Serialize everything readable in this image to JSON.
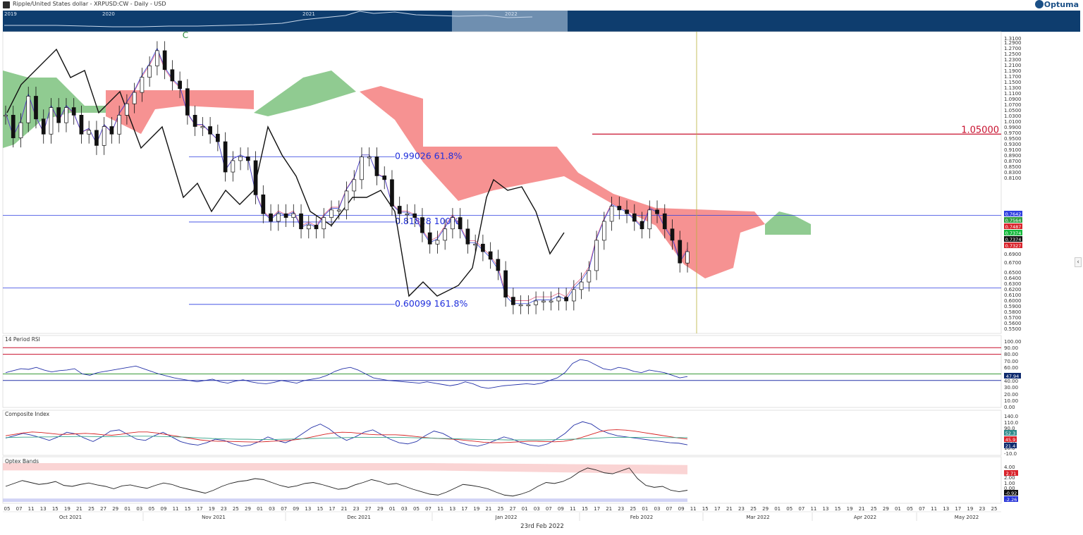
{
  "header": {
    "title": "Ripple/United States dollar - XRPUSD:CW - Daily - USD",
    "brand": "Optuma"
  },
  "navigator": {
    "years": [
      "2019",
      "2020",
      "2021",
      "2022"
    ]
  },
  "footer": {
    "date_label": "23rd Feb 2022"
  },
  "colors": {
    "navigator_bg": "#0e3d6e",
    "navigator_window": "#6f8fb0",
    "cloud_bull": "#7cc27e",
    "cloud_bear": "#f47f7f",
    "fib_line": "#2f3fe0",
    "resistance_line": "#c8102e",
    "price_text": "#1f2fdc"
  },
  "chart_data": [
    {
      "type": "candlestick",
      "title": "Ripple/United States dollar - XRPUSD:CW - Daily - USD",
      "ylim": [
        0.53,
        1.32
      ],
      "y_ticks": [
        "1.3100",
        "1.2900",
        "1.2700",
        "1.2500",
        "1.2300",
        "1.2100",
        "1.1900",
        "1.1700",
        "1.1500",
        "1.1300",
        "1.1100",
        "1.0900",
        "1.0700",
        "1.0500",
        "1.0300",
        "1.0100",
        "0.9900",
        "0.9700",
        "0.9500",
        "0.9300",
        "0.9100",
        "0.8900",
        "0.8700",
        "0.8500",
        "0.8300",
        "0.8100",
        "0.6900",
        "0.6700",
        "0.6500",
        "0.6400",
        "0.6300",
        "0.6200",
        "0.6100",
        "0.6000",
        "0.5900",
        "0.5800",
        "0.5700",
        "0.5600",
        "0.5500"
      ],
      "x_months": [
        "Oct 2021",
        "Nov 2021",
        "Dec 2021",
        "Jan 2022",
        "Feb 2022",
        "Mar 2022",
        "Apr 2022",
        "May 2022"
      ],
      "x_days": [
        "05",
        "07",
        "11",
        "13",
        "15",
        "19",
        "21",
        "25",
        "27",
        "29",
        "01",
        "03",
        "05",
        "09",
        "11",
        "15",
        "17",
        "19",
        "23",
        "25",
        "29",
        "01",
        "03",
        "07",
        "09",
        "13",
        "15",
        "17",
        "21",
        "23",
        "27",
        "29",
        "01",
        "03",
        "05",
        "07",
        "11",
        "13",
        "17",
        "19",
        "21",
        "25",
        "27",
        "01",
        "03",
        "07",
        "09",
        "11",
        "15",
        "17",
        "21",
        "23",
        "25",
        "01",
        "03",
        "07",
        "09",
        "11",
        "15",
        "17",
        "21",
        "23",
        "25",
        "29",
        "01",
        "05",
        "07",
        "11",
        "13",
        "15",
        "19",
        "21",
        "25",
        "29",
        "01",
        "05",
        "07",
        "11",
        "13",
        "17",
        "19",
        "23",
        "25"
      ],
      "wave_label": "C",
      "annotations": [
        {
          "text": "0.99026   61.8%",
          "y": 0.99026
        },
        {
          "text": "0.81828   100%",
          "y": 0.81828
        },
        {
          "text": "0.60099   161.8%",
          "y": 0.60099
        },
        {
          "text": "1.05000",
          "y": 1.05
        }
      ],
      "horizontal_lines": [
        0.8356,
        0.6445
      ],
      "value_badges": [
        {
          "text": "0.7642",
          "color": "#2f3fe0"
        },
        {
          "text": "0.7564",
          "color": "#2e9c3f"
        },
        {
          "text": "0.7487",
          "color": "#d9232b"
        },
        {
          "text": "0.7374",
          "color": "#14b83b"
        },
        {
          "text": "0.7374",
          "color": "#111111"
        },
        {
          "text": "0.7327",
          "color": "#d9232b"
        }
      ],
      "close_series": [
        1.1,
        1.04,
        1.08,
        1.15,
        1.09,
        1.05,
        1.12,
        1.08,
        1.12,
        1.1,
        1.05,
        1.06,
        1.02,
        1.07,
        1.05,
        1.1,
        1.13,
        1.16,
        1.2,
        1.23,
        1.27,
        1.22,
        1.19,
        1.17,
        1.1,
        1.07,
        1.07,
        1.05,
        1.03,
        0.95,
        0.98,
        0.99,
        0.98,
        0.89,
        0.84,
        0.82,
        0.84,
        0.83,
        0.84,
        0.8,
        0.81,
        0.8,
        0.83,
        0.85,
        0.85,
        0.9,
        0.93,
        0.99,
        0.99,
        0.94,
        0.93,
        0.86,
        0.84,
        0.84,
        0.83,
        0.79,
        0.76,
        0.77,
        0.8,
        0.83,
        0.8,
        0.76,
        0.76,
        0.74,
        0.72,
        0.69,
        0.62,
        0.6,
        0.6,
        0.6,
        0.61,
        0.61,
        0.61,
        0.62,
        0.61,
        0.64,
        0.66,
        0.69,
        0.77,
        0.82,
        0.86,
        0.85,
        0.84,
        0.82,
        0.8,
        0.85,
        0.84,
        0.8,
        0.77,
        0.71,
        0.74
      ]
    },
    {
      "type": "line",
      "title": "14 Period RSI",
      "ylim": [
        0,
        100
      ],
      "y_ticks": [
        "100.00",
        "90.00",
        "80.00",
        "70.00",
        "60.00",
        "50.00",
        "40.00",
        "30.00",
        "20.00",
        "10.00",
        "0.00"
      ],
      "levels": [
        90,
        80,
        50,
        40
      ],
      "last_value": "47.94",
      "values": [
        52,
        55,
        58,
        57,
        60,
        56,
        53,
        55,
        56,
        58,
        50,
        48,
        52,
        54,
        56,
        58,
        60,
        62,
        58,
        54,
        50,
        47,
        44,
        42,
        40,
        38,
        40,
        42,
        38,
        36,
        39,
        41,
        38,
        36,
        35,
        37,
        40,
        38,
        36,
        40,
        42,
        44,
        48,
        54,
        58,
        60,
        56,
        50,
        44,
        42,
        40,
        39,
        38,
        37,
        36,
        38,
        36,
        34,
        32,
        34,
        38,
        35,
        30,
        28,
        30,
        32,
        33,
        34,
        35,
        34,
        36,
        40,
        44,
        52,
        66,
        72,
        70,
        64,
        58,
        56,
        60,
        58,
        54,
        52,
        56,
        54,
        52,
        48,
        44,
        46
      ]
    },
    {
      "type": "line",
      "title": "Composite Index",
      "ylim": [
        -15,
        145
      ],
      "y_ticks": [
        "140.0",
        "110.0",
        "90.0",
        "70.0",
        "50.0",
        "30.0",
        "10.0",
        "-10.0"
      ],
      "last_values": [
        "52.3",
        "45.9",
        "21.4"
      ],
      "series": [
        {
          "color": "#2532a8",
          "values": [
            50,
            60,
            70,
            62,
            52,
            40,
            55,
            75,
            68,
            50,
            35,
            55,
            80,
            85,
            65,
            45,
            40,
            60,
            75,
            55,
            35,
            25,
            20,
            30,
            45,
            40,
            25,
            15,
            20,
            35,
            55,
            40,
            30,
            45,
            70,
            95,
            110,
            90,
            60,
            40,
            55,
            75,
            85,
            65,
            45,
            30,
            25,
            35,
            60,
            80,
            70,
            50,
            30,
            20,
            15,
            25,
            40,
            55,
            45,
            30,
            20,
            15,
            25,
            45,
            70,
            105,
            120,
            110,
            85,
            70,
            60,
            55,
            50,
            45,
            40,
            35,
            30,
            28,
            21
          ]
        },
        {
          "color": "#d62020",
          "values": [
            60,
            66,
            72,
            76,
            74,
            70,
            66,
            66,
            68,
            70,
            68,
            64,
            62,
            66,
            72,
            76,
            76,
            72,
            66,
            60,
            54,
            48,
            42,
            38,
            36,
            36,
            35,
            34,
            33,
            34,
            36,
            38,
            40,
            44,
            50,
            58,
            66,
            72,
            75,
            74,
            70,
            66,
            64,
            64,
            64,
            62,
            58,
            54,
            50,
            48,
            46,
            44,
            40,
            36,
            32,
            30,
            30,
            32,
            34,
            36,
            36,
            35,
            34,
            36,
            42,
            52,
            64,
            76,
            84,
            86,
            84,
            80,
            74,
            68,
            62,
            56,
            50,
            46
          ]
        },
        {
          "color": "#3aa58a",
          "values": [
            52,
            53,
            54,
            54,
            55,
            55,
            56,
            56,
            57,
            57,
            56,
            56,
            56,
            57,
            58,
            58,
            58,
            57,
            56,
            55,
            54,
            52,
            50,
            48,
            47,
            46,
            45,
            45,
            44,
            44,
            44,
            45,
            46,
            47,
            48,
            49,
            50,
            51,
            52,
            53,
            53,
            53,
            53,
            53,
            53,
            52,
            51,
            50,
            49,
            48,
            47,
            46,
            45,
            44,
            43,
            43,
            42,
            42,
            42,
            42,
            42,
            43,
            44,
            45,
            46,
            48,
            50,
            52,
            53,
            53,
            53,
            53,
            52,
            52,
            52,
            52,
            52
          ]
        }
      ]
    },
    {
      "type": "line",
      "title": "Optex Bands",
      "ylim": [
        -3,
        5
      ],
      "y_ticks": [
        "4.00",
        "3.00",
        "2.00",
        "1.00",
        "0.00",
        "-1.00"
      ],
      "last_values": [
        "2.71",
        "-0.92",
        "-2.26"
      ],
      "values": [
        0.2,
        0.8,
        1.4,
        1.0,
        0.6,
        0.8,
        1.2,
        0.4,
        0.2,
        0.6,
        0.9,
        0.5,
        0.2,
        -0.3,
        0.3,
        0.5,
        0.1,
        -0.2,
        0.4,
        0.9,
        0.6,
        0.0,
        -0.4,
        -0.8,
        -1.2,
        -0.6,
        0.2,
        0.8,
        1.2,
        1.4,
        1.8,
        1.6,
        1.0,
        0.4,
        0.0,
        0.3,
        0.8,
        1.0,
        0.6,
        0.1,
        -0.4,
        -0.2,
        0.5,
        1.0,
        1.6,
        1.2,
        0.6,
        0.8,
        0.2,
        -0.4,
        -0.9,
        -1.4,
        -1.6,
        -1.0,
        -0.2,
        0.6,
        0.4,
        0.1,
        -0.3,
        -1.0,
        -1.6,
        -1.8,
        -1.4,
        -0.8,
        0.2,
        1.0,
        0.8,
        1.2,
        2.0,
        3.2,
        4.0,
        3.6,
        3.0,
        2.8,
        3.4,
        4.0,
        1.8,
        0.4,
        0.0,
        0.2,
        -0.6,
        -0.9,
        -0.6
      ]
    }
  ]
}
